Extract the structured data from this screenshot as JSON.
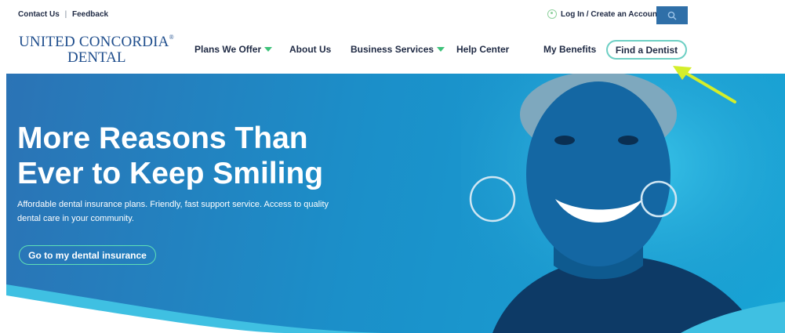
{
  "utility": {
    "contact": "Contact Us",
    "separator": "|",
    "feedback": "Feedback",
    "login": "Log In / Create an Account"
  },
  "brand": {
    "line1": "UNITED CONCORDIA",
    "line2": "DENTAL",
    "reg": "®"
  },
  "nav": {
    "items": [
      {
        "label": "Plans We Offer",
        "dropdown": true
      },
      {
        "label": "About Us",
        "dropdown": false
      },
      {
        "label": "Business Services",
        "dropdown": true
      },
      {
        "label": "Help Center",
        "dropdown": false
      },
      {
        "label": "My Benefits",
        "dropdown": false
      }
    ],
    "cta": "Find a Dentist"
  },
  "hero": {
    "title": "More Reasons Than\nEver to Keep Smiling",
    "subtitle": "Affordable dental insurance plans. Friendly, fast support service. Access to quality dental care in your community.",
    "cta": "Go to my dental insurance"
  },
  "colors": {
    "brand_blue": "#1e4d8c",
    "accent_green": "#3ec27a",
    "hero_blue": "#1b8fc9",
    "annotation_arrow": "#d4ee2b"
  },
  "icons": {
    "search": "search-icon",
    "user": "user-icon",
    "arrow": "annotation-arrow"
  }
}
